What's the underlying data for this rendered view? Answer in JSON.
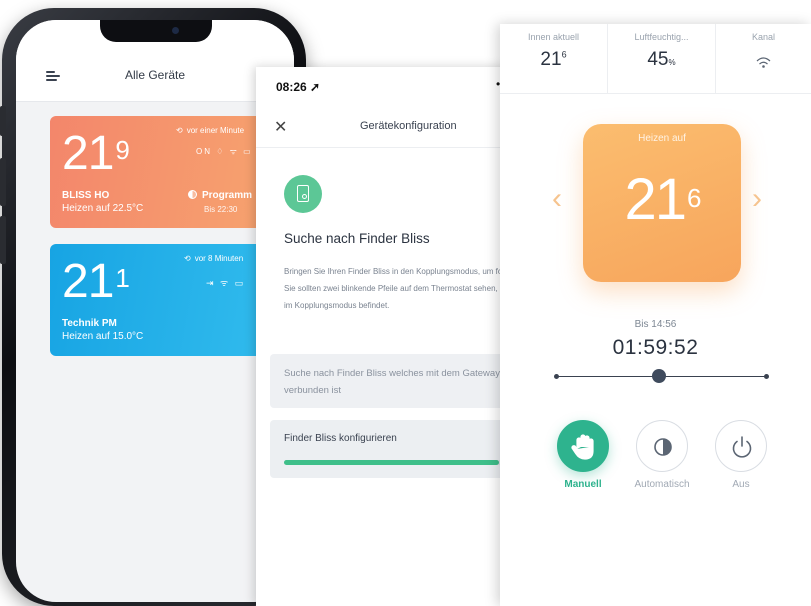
{
  "phone": {
    "title": "Alle Geräte",
    "devices": [
      {
        "temp": "21",
        "decimal": "9",
        "name": "BLISS HO",
        "status": "Heizen auf 22.5°C",
        "updated": "vor einer Minute",
        "icons": "ON ♢ ᯤ ▭",
        "mode": "Programm",
        "until": "Bis 22:30"
      },
      {
        "temp": "21",
        "decimal": "1",
        "name": "Technik PM",
        "status": "Heizen auf 15.0°C",
        "updated": "vor 8 Minuten",
        "icons": "⇥ ᯤ ▭"
      }
    ]
  },
  "config": {
    "time": "08:26 ➚",
    "dots": "•",
    "title": "Gerätekonfiguration",
    "search_title": "Suche nach Finder Bliss",
    "description": "Bringen Sie Ihren Finder Bliss in den Kopplungsmodus, um fortzufahren. Sie sollten zwei blinkende Pfeile auf dem Thermostat sehen, wenn er sich im Kopplungsmodus befindet.",
    "step1": "Suche nach Finder Bliss welches mit dem Gateway verbunden ist",
    "step2": "Finder Bliss konfigurieren",
    "progress": 0.82
  },
  "thermostat": {
    "stats": [
      {
        "label": "Innen aktuell",
        "value": "21",
        "unit": "6"
      },
      {
        "label": "Luftfeuchtig...",
        "value": "45",
        "unit": "%"
      },
      {
        "label": "Kanal",
        "value": "",
        "unit": ""
      }
    ],
    "tile_label": "Heizen auf",
    "temp": "21",
    "decimal": "6",
    "until": "Bis 14:56",
    "timer": "01:59:52",
    "slider_position": 0.49,
    "modes": [
      {
        "label": "Manuell",
        "active": true
      },
      {
        "label": "Automatisch",
        "active": false
      },
      {
        "label": "Aus",
        "active": false
      }
    ]
  },
  "colors": {
    "orange_card": "#f3866b",
    "blue_card": "#17a4e3",
    "tile": "#fbbd6f",
    "accent_green": "#2eb38e"
  }
}
